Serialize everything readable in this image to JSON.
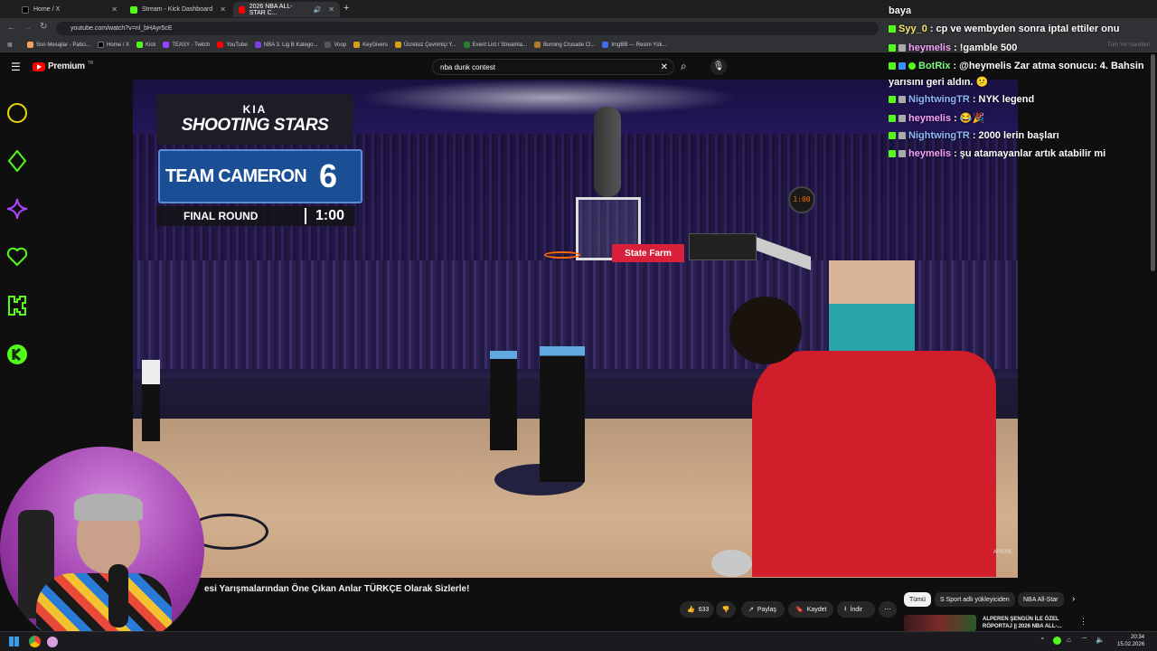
{
  "browser": {
    "tabs": [
      {
        "label": "Home / X",
        "active": false
      },
      {
        "label": "Stream - Kick Dashboard",
        "active": false
      },
      {
        "label": "2026 NBA ALL-STAR C...",
        "active": true
      }
    ],
    "url": "youtube.com/watch?v=nl_bHAyr5cE",
    "bookmarks": [
      "Son Mesajlar - Patici...",
      "Home / X",
      "Kick",
      "TEASY - Twitch",
      "YouTube",
      "NBA 3. Lig B Katego...",
      "Voop",
      "KeyGivers",
      "Ücretsiz Çevrimiçi Y...",
      "Event List / Streamla...",
      "Burning Crusade Cl...",
      "ImgBB — Resim Yük..."
    ],
    "all_bookmarks": "Tüm Yer İşaretleri"
  },
  "youtube": {
    "logo": "Premium",
    "logo_sup": "TR",
    "search_value": "nba dunk contest",
    "video_title": "esi Yarışmalarından Öne Çıkan Anlar TÜRKÇE Olarak Sizlerle!",
    "actions": {
      "likes": "633",
      "share": "Paylaş",
      "save": "Kaydet",
      "download": "İndir"
    },
    "chips": [
      "Tümü",
      "S Sport adlı yükleyiciden",
      "NBA All-Star"
    ],
    "related_title_1": "ALPEREN ŞENGÜN İLE ÖZEL",
    "related_title_2": "RÖPORTAJ || 2026 NBA ALL-..."
  },
  "scoreboard": {
    "brand": "KIA",
    "title": "SHOOTING STARS",
    "team": "TEAM CAMERON",
    "score": "6",
    "round": "FINAL ROUND",
    "time": "1:00",
    "shot_clock": "1:00"
  },
  "court_sign": "State Farm",
  "watermark": "ARENE",
  "chat": [
    {
      "user": "",
      "text": "baya"
    },
    {
      "user": "Syy_0",
      "text": "cp ve wembyden sonra iptal ettiler onu"
    },
    {
      "user": "heymelis",
      "text": "!gamble 500"
    },
    {
      "user": "BotRix",
      "text": "@heymelis Zar atma sonucu: 4. Bahsin"
    },
    {
      "user": "",
      "text": "yarısını geri aldın. 😕"
    },
    {
      "user": "NightwingTR",
      "text": "NYK legend"
    },
    {
      "user": "heymelis",
      "text": "😂🎉"
    },
    {
      "user": "NightwingTR",
      "text": "2000 lerin başları"
    },
    {
      "user": "heymelis",
      "text": "şu atamayanlar artık atabilir mi"
    }
  ],
  "taskbar": {
    "time": "20:34",
    "date": "15.02.2026"
  },
  "colors": {
    "kick_green": "#53fc18",
    "score_blue": "#1a4f96",
    "youtube_red": "#ff0000"
  }
}
